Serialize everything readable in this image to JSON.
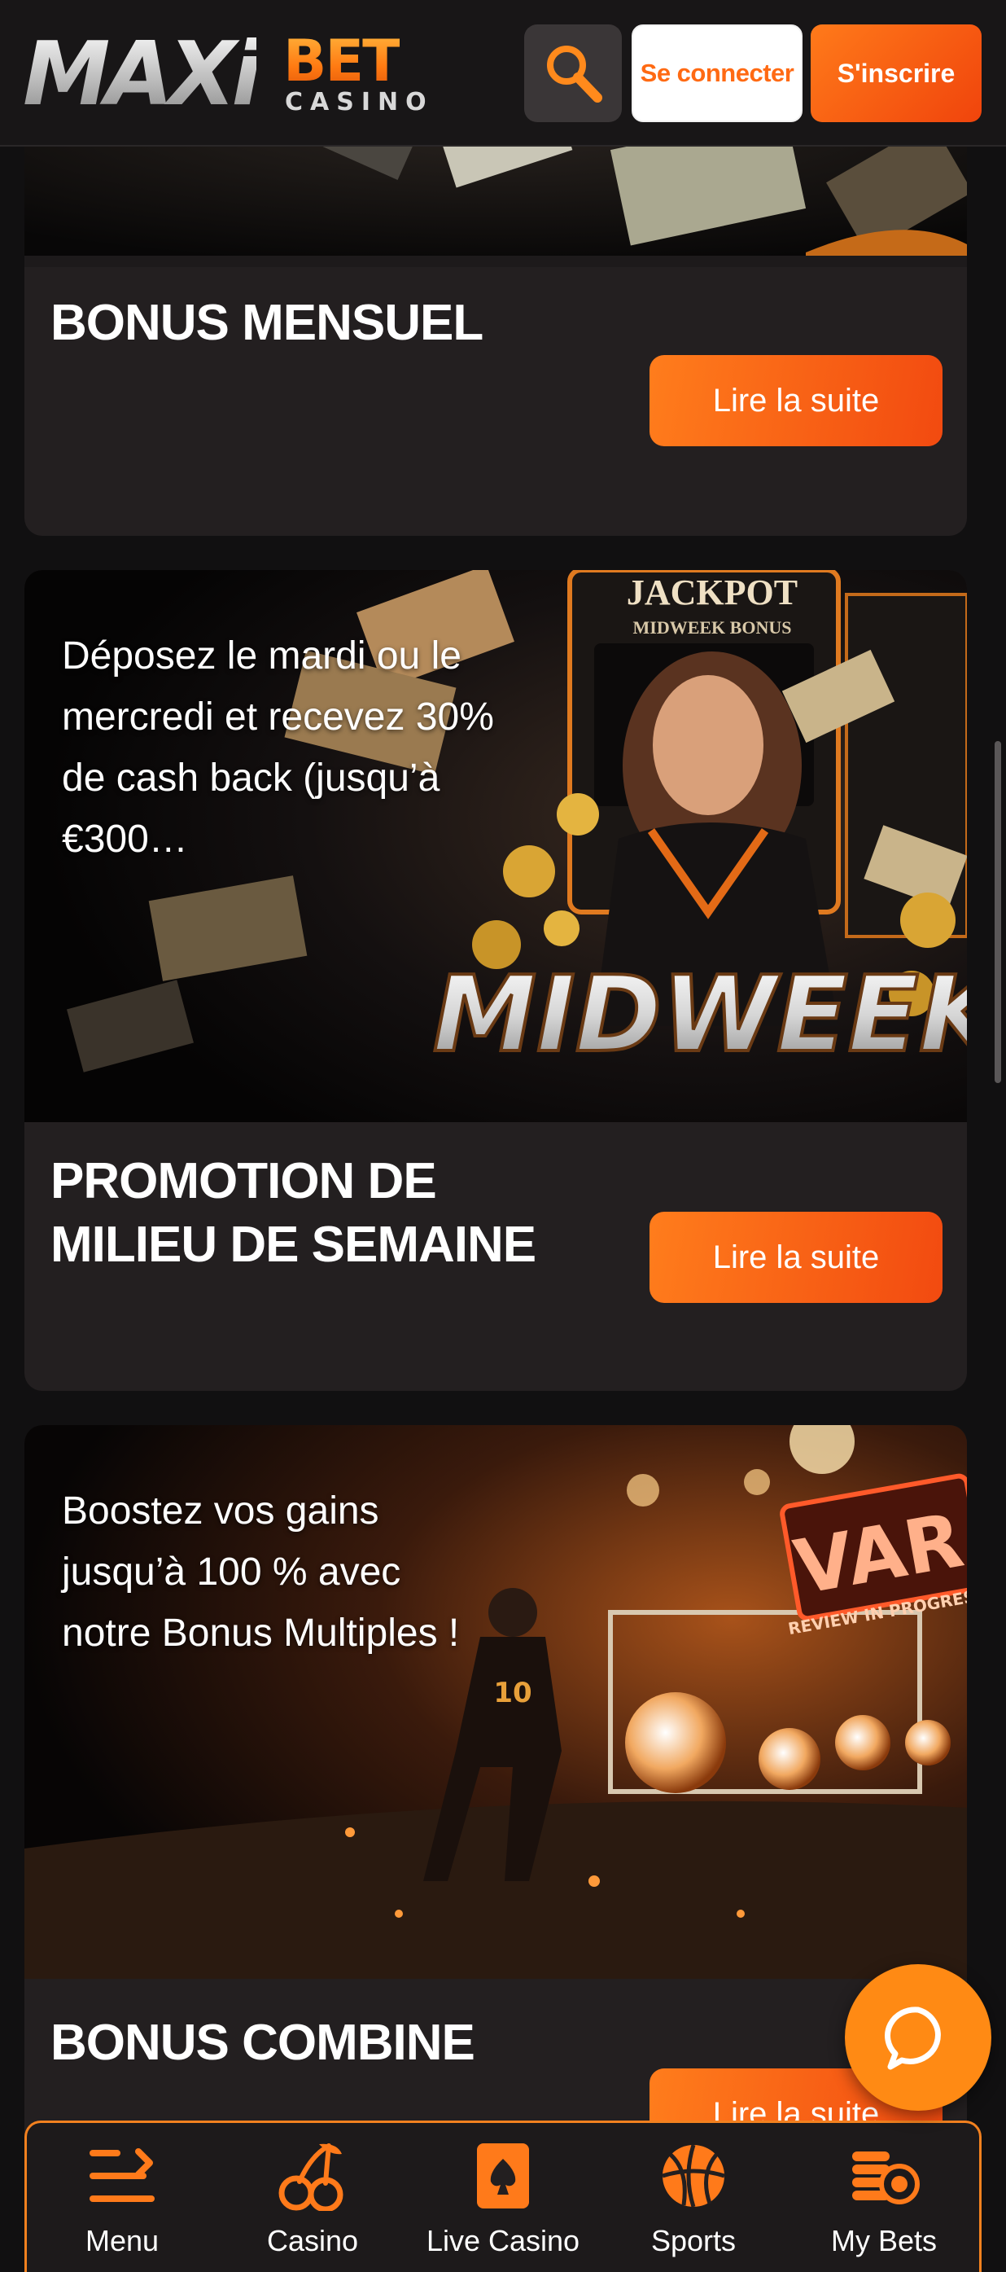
{
  "header": {
    "logo_maxi": "MAXi",
    "logo_bet": "BET",
    "logo_casino": "CASINO",
    "login_label": "Se connecter",
    "signup_label": "S'inscrire",
    "search_icon": "search-icon"
  },
  "cards": [
    {
      "title": "BONUS MENSUEL",
      "button_label": "Lire la suite"
    },
    {
      "promo_text": "Déposez le mardi ou le mercredi et recevez 30% de cash back (jusqu’à €300…",
      "banner_jackpot": "JACKPOT",
      "banner_sub": "MIDWEEK BONUS",
      "banner_headline": "MIDWEEK",
      "title": "PROMOTION DE MILIEU DE SEMAINE",
      "button_label": "Lire la suite"
    },
    {
      "promo_text": "Boostez vos gains jusqu’à 100 % avec notre Bonus Multiples !",
      "banner_var": "VAR",
      "banner_var_sub": "REVIEW IN PROGRESS",
      "player_number": "10",
      "title": "BONUS COMBINE",
      "button_label": "Lire la suite"
    }
  ],
  "bottom_nav": [
    {
      "label": "Menu",
      "icon": "menu-icon"
    },
    {
      "label": "Casino",
      "icon": "cherries-icon"
    },
    {
      "label": "Live Casino",
      "icon": "playing-card-icon"
    },
    {
      "label": "Sports",
      "icon": "basketball-icon"
    },
    {
      "label": "My Bets",
      "icon": "coins-icon"
    }
  ],
  "colors": {
    "accent": "#ff7a1a",
    "accent_dark": "#f0440c",
    "card_bg": "#231f20",
    "page_bg": "#111011"
  }
}
